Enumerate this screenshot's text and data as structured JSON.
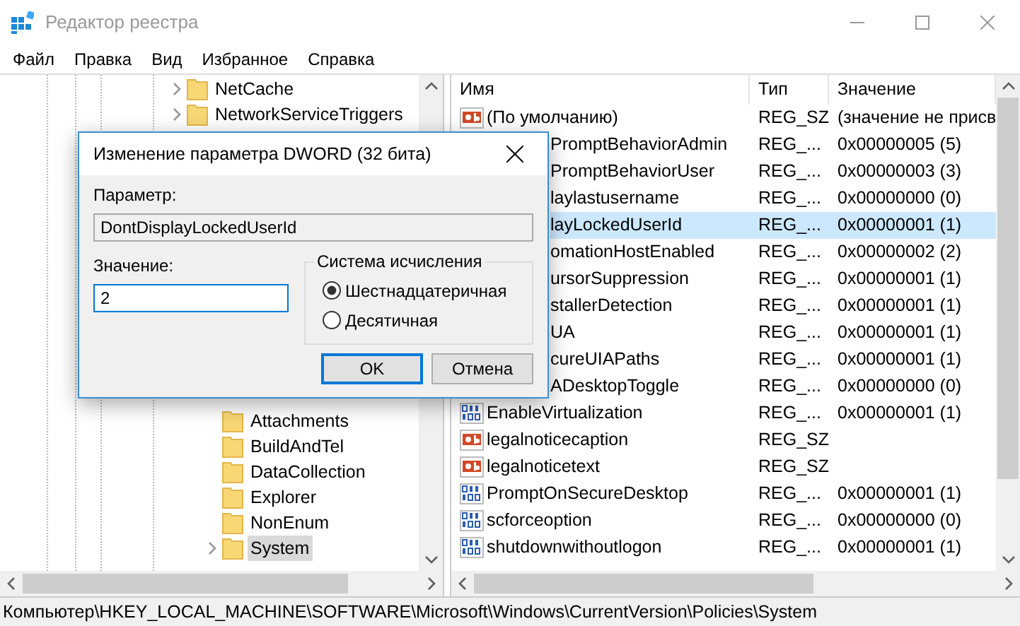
{
  "window": {
    "title": "Редактор реестра"
  },
  "menu": [
    "Файл",
    "Правка",
    "Вид",
    "Избранное",
    "Справка"
  ],
  "tree": {
    "items": [
      {
        "label": "NetCache",
        "expandable": true,
        "selected": false
      },
      {
        "label": "NetworkServiceTriggers",
        "expandable": true,
        "selected": false
      },
      {
        "label": "Attachments",
        "expandable": false,
        "selected": false
      },
      {
        "label": "BuildAndTel",
        "expandable": false,
        "selected": false
      },
      {
        "label": "DataCollection",
        "expandable": false,
        "selected": false
      },
      {
        "label": "Explorer",
        "expandable": false,
        "selected": false
      },
      {
        "label": "NonEnum",
        "expandable": false,
        "selected": false
      },
      {
        "label": "System",
        "expandable": true,
        "selected": true
      }
    ]
  },
  "table": {
    "columns": [
      "Имя",
      "Тип",
      "Значение"
    ],
    "rows": [
      {
        "kind": "string",
        "covered": false,
        "selected": false,
        "name": "(По умолчанию)",
        "type": "REG_SZ",
        "value": "(значение не присв"
      },
      {
        "kind": "dword",
        "covered": true,
        "selected": false,
        "name": "PromptBehaviorAdmin",
        "type": "REG_...",
        "value": "0x00000005 (5)"
      },
      {
        "kind": "dword",
        "covered": true,
        "selected": false,
        "name": "PromptBehaviorUser",
        "type": "REG_...",
        "value": "0x00000003 (3)"
      },
      {
        "kind": "dword",
        "covered": true,
        "selected": false,
        "name": "laylastusername",
        "type": "REG_...",
        "value": "0x00000000 (0)"
      },
      {
        "kind": "dword",
        "covered": true,
        "selected": true,
        "name": "layLockedUserId",
        "type": "REG_...",
        "value": "0x00000001 (1)"
      },
      {
        "kind": "dword",
        "covered": true,
        "selected": false,
        "name": "omationHostEnabled",
        "type": "REG_...",
        "value": "0x00000002 (2)"
      },
      {
        "kind": "dword",
        "covered": true,
        "selected": false,
        "name": "ursorSuppression",
        "type": "REG_...",
        "value": "0x00000001 (1)"
      },
      {
        "kind": "dword",
        "covered": true,
        "selected": false,
        "name": "stallerDetection",
        "type": "REG_...",
        "value": "0x00000001 (1)"
      },
      {
        "kind": "dword",
        "covered": true,
        "selected": false,
        "name": "UA",
        "type": "REG_...",
        "value": "0x00000001 (1)"
      },
      {
        "kind": "dword",
        "covered": true,
        "selected": false,
        "name": "cureUIAPaths",
        "type": "REG_...",
        "value": "0x00000001 (1)"
      },
      {
        "kind": "dword",
        "covered": true,
        "selected": false,
        "name": "ADesktopToggle",
        "type": "REG_...",
        "value": "0x00000000 (0)"
      },
      {
        "kind": "dword",
        "covered": false,
        "selected": false,
        "name": "EnableVirtualization",
        "type": "REG_...",
        "value": "0x00000001 (1)"
      },
      {
        "kind": "string",
        "covered": false,
        "selected": false,
        "name": "legalnoticecaption",
        "type": "REG_SZ"
      },
      {
        "kind": "string",
        "covered": false,
        "selected": false,
        "name": "legalnoticetext",
        "type": "REG_SZ"
      },
      {
        "kind": "dword",
        "covered": false,
        "selected": false,
        "name": "PromptOnSecureDesktop",
        "type": "REG_...",
        "value": "0x00000001 (1)"
      },
      {
        "kind": "dword",
        "covered": false,
        "selected": false,
        "name": "scforceoption",
        "type": "REG_...",
        "value": "0x00000000 (0)"
      },
      {
        "kind": "dword",
        "covered": false,
        "selected": false,
        "name": "shutdownwithoutlogon",
        "type": "REG_...",
        "value": "0x00000001 (1)"
      }
    ]
  },
  "status_bar": "Компьютер\\HKEY_LOCAL_MACHINE\\SOFTWARE\\Microsoft\\Windows\\CurrentVersion\\Policies\\System",
  "dialog": {
    "title": "Изменение параметра DWORD (32 бита)",
    "name_label": "Параметр:",
    "name_value": "DontDisplayLockedUserId",
    "value_label": "Значение:",
    "value": "2",
    "base_group": "Система исчисления",
    "bases": [
      {
        "label": "Шестнадцатеричная",
        "selected": true
      },
      {
        "label": "Десятичная",
        "selected": false
      }
    ],
    "buttons": [
      {
        "label": "OK",
        "default": true
      },
      {
        "label": "Отмена",
        "default": false
      }
    ]
  }
}
